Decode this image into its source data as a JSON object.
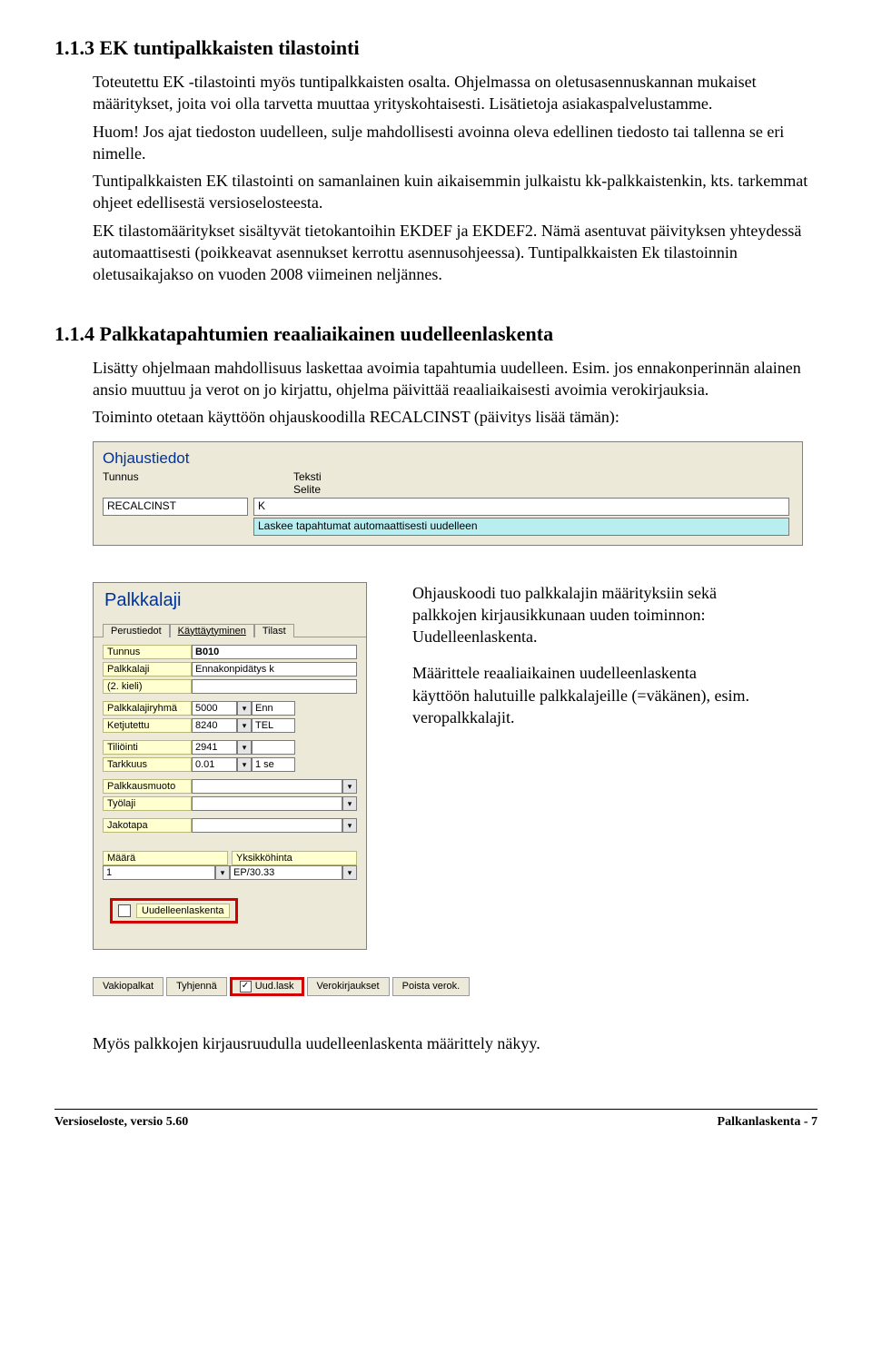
{
  "section1": {
    "heading": "1.1.3 EK tuntipalkkaisten tilastointi",
    "p1": "Toteutettu EK -tilastointi myös tuntipalkkaisten osalta. Ohjelmassa on oletusasennuskannan mukaiset määritykset, joita voi olla tarvetta muuttaa yrityskohtaisesti. Lisätietoja asiakaspalvelustamme.",
    "p2": "Huom! Jos ajat tiedoston uudelleen, sulje mahdollisesti avoinna oleva edellinen tiedosto tai tallenna se eri nimelle.",
    "p3": "Tuntipalkkaisten EK tilastointi on samanlainen kuin aikaisemmin julkaistu kk-palkkaistenkin, kts. tarkemmat ohjeet edellisestä versioselosteesta.",
    "p4": "EK tilastomääritykset sisältyvät tietokantoihin EKDEF ja EKDEF2. Nämä asentuvat päivityksen yhteydessä automaattisesti (poikkeavat asennukset kerrottu asennusohjeessa). Tuntipalkkaisten Ek tilastoinnin oletusaikajakso on vuoden 2008 viimeinen neljännes."
  },
  "section2": {
    "heading": "1.1.4 Palkkatapahtumien reaaliaikainen uudelleenlaskenta",
    "p1": "Lisätty ohjelmaan mahdollisuus laskettaa avoimia tapahtumia uudelleen. Esim. jos ennakonperinnän alainen ansio muuttuu ja verot on jo kirjattu, ohjelma päivittää reaaliaikaisesti avoimia verokirjauksia.",
    "p2": "Toiminto otetaan käyttöön ohjauskoodilla RECALCINST (päivitys lisää tämän):"
  },
  "ohjaustiedot": {
    "boxtitle": "Ohjaustiedot",
    "label_tunnus": "Tunnus",
    "label_teksti": "Teksti",
    "label_selite": "Selite",
    "value_tunnus": "RECALCINST",
    "value_teksti": "K",
    "value_selite": "Laskee tapahtumat automaattisesti uudelleen"
  },
  "palkkalaji": {
    "boxtitle": "Palkkalaji",
    "tabs": {
      "t1": "Perustiedot",
      "t2": "Käyttäytyminen",
      "t3": "Tilast"
    },
    "fields": {
      "tunnus_label": "Tunnus",
      "tunnus_value": "B010",
      "palkkalaji_label": "Palkkalaji",
      "palkkalaji_value": "Ennakonpidätys k",
      "kieli_label": "(2. kieli)",
      "ryhma_label": "Palkkalajiryhmä",
      "ryhma_value": "5000",
      "ryhma_value2": "Enn",
      "ketjutettu_label": "Ketjutettu",
      "ketjutettu_value": "8240",
      "ketjutettu_value2": "TEL",
      "tiliointi_label": "Tiliöinti",
      "tiliointi_value": "2941",
      "tarkkuus_label": "Tarkkuus",
      "tarkkuus_value": "0.01",
      "tarkkuus_value2": "1 se",
      "palkkausmuoto_label": "Palkkausmuoto",
      "tyolaji_label": "Työlaji",
      "jakotapa_label": "Jakotapa",
      "maara_label": "Määrä",
      "maara_value": "1",
      "yksikkohinta_label": "Yksikköhinta",
      "yksikkohinta_value": "EP/30.33",
      "uudelleenlaskenta": "Uudelleenlaskenta"
    }
  },
  "sidetext": {
    "p1": "Ohjauskoodi tuo palkkalajin määrityksiin sekä palkkojen kirjausikkunaan uuden toiminnon: Uudelleenlaskenta.",
    "p2": "Määrittele reaaliaikainen uudelleenlaskenta käyttöön halutuille palkkalajeille (=väkänen), esim. veropalkkalajit."
  },
  "buttonbar": {
    "b1": "Vakiopalkat",
    "b2": "Tyhjennä",
    "b3": "Uud.lask",
    "b4": "Verokirjaukset",
    "b5": "Poista verok."
  },
  "closing_p": "Myös palkkojen kirjausruudulla uudelleenlaskenta määrittely näkyy.",
  "footer": {
    "left": "Versioseloste, versio 5.60",
    "right": "Palkanlaskenta - 7"
  }
}
